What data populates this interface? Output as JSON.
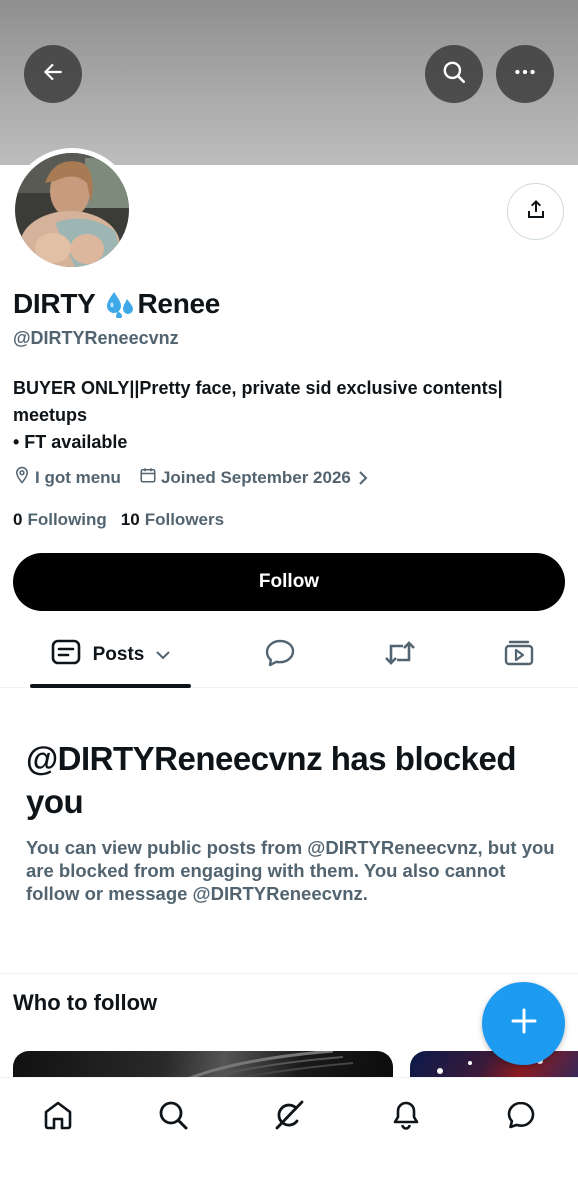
{
  "header": {
    "back_icon": "arrow-left-icon",
    "search_icon": "search-icon",
    "more_icon": "more-horizontal-icon",
    "banner_color": "#a9a9a9"
  },
  "profile": {
    "display_name_part1": "DIRTY",
    "display_name_emoji": "sweat-droplets-emoji",
    "display_name_part2": "Renee",
    "handle": "@DIRTYReneecvnz",
    "bio_lines": [
      "BUYER ONLY||Pretty face, private sid exclusive contents|",
      "meetups",
      "• FT available"
    ],
    "location": "I got menu",
    "joined": "Joined September 2026",
    "following_count": "0",
    "following_label": "Following",
    "followers_count": "10",
    "followers_label": "Followers",
    "follow_button": "Follow",
    "share_icon": "share-icon"
  },
  "tabs": {
    "posts_label": "Posts",
    "items": [
      "posts-icon",
      "replies-icon",
      "reposts-icon",
      "media-icon"
    ]
  },
  "blocked": {
    "title": "@DIRTYReneecvnz has blocked you",
    "message": "You can view public posts from @DIRTYReneecvnz, but you are blocked from engaging with them. You also cannot follow or message @DIRTYReneecvnz."
  },
  "who_to_follow": {
    "title": "Who to follow"
  },
  "fab": {
    "icon": "plus-icon",
    "color": "#1d9bf0"
  },
  "bottom_nav": {
    "items": [
      "home-icon",
      "search-icon",
      "grok-icon",
      "notifications-icon",
      "messages-icon"
    ]
  }
}
